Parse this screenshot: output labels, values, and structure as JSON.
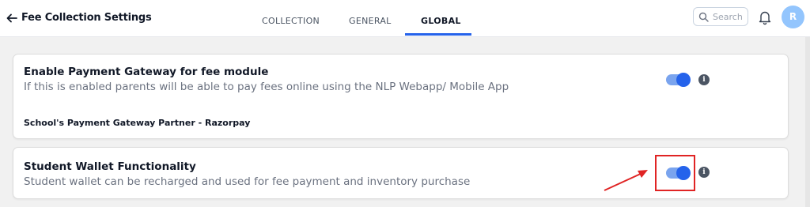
{
  "header": {
    "title": "Fee Collection Settings",
    "tabs": [
      {
        "label": "COLLECTION",
        "active": false
      },
      {
        "label": "GENERAL",
        "active": false
      },
      {
        "label": "GLOBAL",
        "active": true
      }
    ],
    "search": {
      "placeholder": "Search"
    },
    "avatar_initial": "R",
    "accent_color": "#2563eb"
  },
  "settings": [
    {
      "title": "Enable Payment Gateway for fee module",
      "description": "If this is enabled parents will be able to pay fees online using the NLP Webapp/ Mobile App",
      "partner": "School's Payment Gateway Partner - Razorpay",
      "enabled": true,
      "info_icon": "i"
    },
    {
      "title": "Student Wallet Functionality",
      "description": "Student wallet can be recharged and used for fee payment and inventory purchase",
      "enabled": true,
      "info_icon": "i"
    }
  ],
  "annotation": {
    "color": "#e02424"
  }
}
